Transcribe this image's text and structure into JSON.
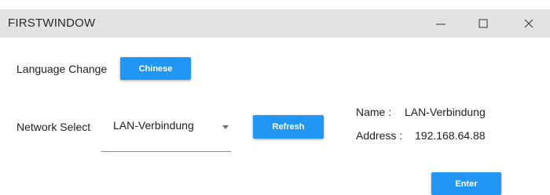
{
  "window": {
    "title": "FIRSTWINDOW",
    "minimize_icon": "minimize-icon",
    "maximize_icon": "maximize-icon",
    "close_icon": "close-icon"
  },
  "language": {
    "label": "Language Change",
    "button_label": "Chinese"
  },
  "network": {
    "label": "Network Select",
    "selected": "LAN-Verbindung",
    "refresh_label": "Refresh"
  },
  "info": {
    "name_label": "Name :",
    "name_value": "LAN-Verbindung",
    "address_label": "Address :",
    "address_value": "192.168.64.88"
  },
  "enter_label": "Enter",
  "colors": {
    "accent": "#2196f3",
    "titlebar": "#e3e3e3"
  }
}
